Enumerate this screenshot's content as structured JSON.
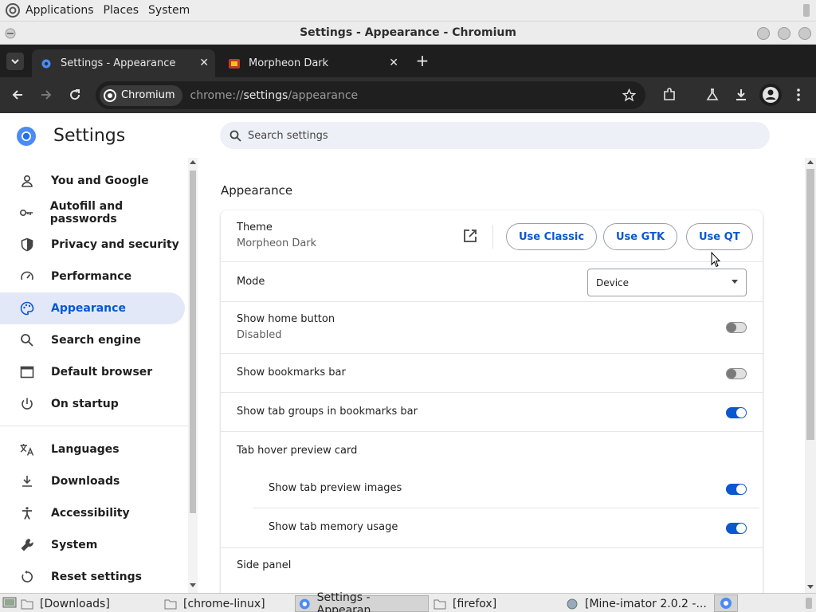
{
  "top_panel": {
    "menus": [
      "Applications",
      "Places",
      "System"
    ]
  },
  "window": {
    "title": "Settings - Appearance - Chromium"
  },
  "tabs": [
    {
      "label": "Settings - Appearance",
      "active": true
    },
    {
      "label": "Morpheon Dark",
      "active": false
    }
  ],
  "toolbar": {
    "chip_label": "Chromium",
    "url_prefix": "chrome://",
    "url_host": "settings",
    "url_path": "/appearance"
  },
  "settings": {
    "title": "Settings",
    "search_placeholder": "Search settings"
  },
  "sidebar": {
    "items": [
      {
        "label": "You and Google",
        "icon": "person-icon"
      },
      {
        "label": "Autofill and passwords",
        "icon": "key-icon"
      },
      {
        "label": "Privacy and security",
        "icon": "shield-icon"
      },
      {
        "label": "Performance",
        "icon": "speedometer-icon"
      },
      {
        "label": "Appearance",
        "icon": "palette-icon",
        "active": true
      },
      {
        "label": "Search engine",
        "icon": "search-icon"
      },
      {
        "label": "Default browser",
        "icon": "browser-window-icon"
      },
      {
        "label": "On startup",
        "icon": "power-icon"
      },
      {
        "label": "Languages",
        "icon": "translate-icon"
      },
      {
        "label": "Downloads",
        "icon": "download-icon"
      },
      {
        "label": "Accessibility",
        "icon": "accessibility-icon"
      },
      {
        "label": "System",
        "icon": "wrench-icon"
      },
      {
        "label": "Reset settings",
        "icon": "reset-icon"
      }
    ]
  },
  "appearance": {
    "section_title": "Appearance",
    "theme": {
      "label": "Theme",
      "value": "Morpheon Dark",
      "buttons": [
        "Use Classic",
        "Use GTK",
        "Use QT"
      ]
    },
    "mode": {
      "label": "Mode",
      "selected": "Device"
    },
    "show_home_button": {
      "label": "Show home button",
      "sub": "Disabled",
      "enabled": false
    },
    "show_bookmarks_bar": {
      "label": "Show bookmarks bar",
      "enabled": false
    },
    "show_tab_groups": {
      "label": "Show tab groups in bookmarks bar",
      "enabled": true
    },
    "tab_hover_preview": {
      "label": "Tab hover preview card"
    },
    "show_tab_preview_images": {
      "label": "Show tab preview images",
      "enabled": true
    },
    "show_tab_memory_usage": {
      "label": "Show tab memory usage",
      "enabled": true
    },
    "side_panel": {
      "label": "Side panel"
    }
  },
  "taskbar": {
    "items": [
      {
        "label": "[Downloads]"
      },
      {
        "label": "[chrome-linux]"
      },
      {
        "label": "Settings - Appearan...",
        "active": true
      },
      {
        "label": "[firefox]"
      },
      {
        "label": "[Mine-imator 2.0.2 -..."
      }
    ]
  },
  "colors": {
    "accent": "#0b57d0",
    "active_nav_bg": "#e3e8f8",
    "toolbar_bg": "#2f2f2f",
    "tabstrip_bg": "#1e1e1e"
  }
}
